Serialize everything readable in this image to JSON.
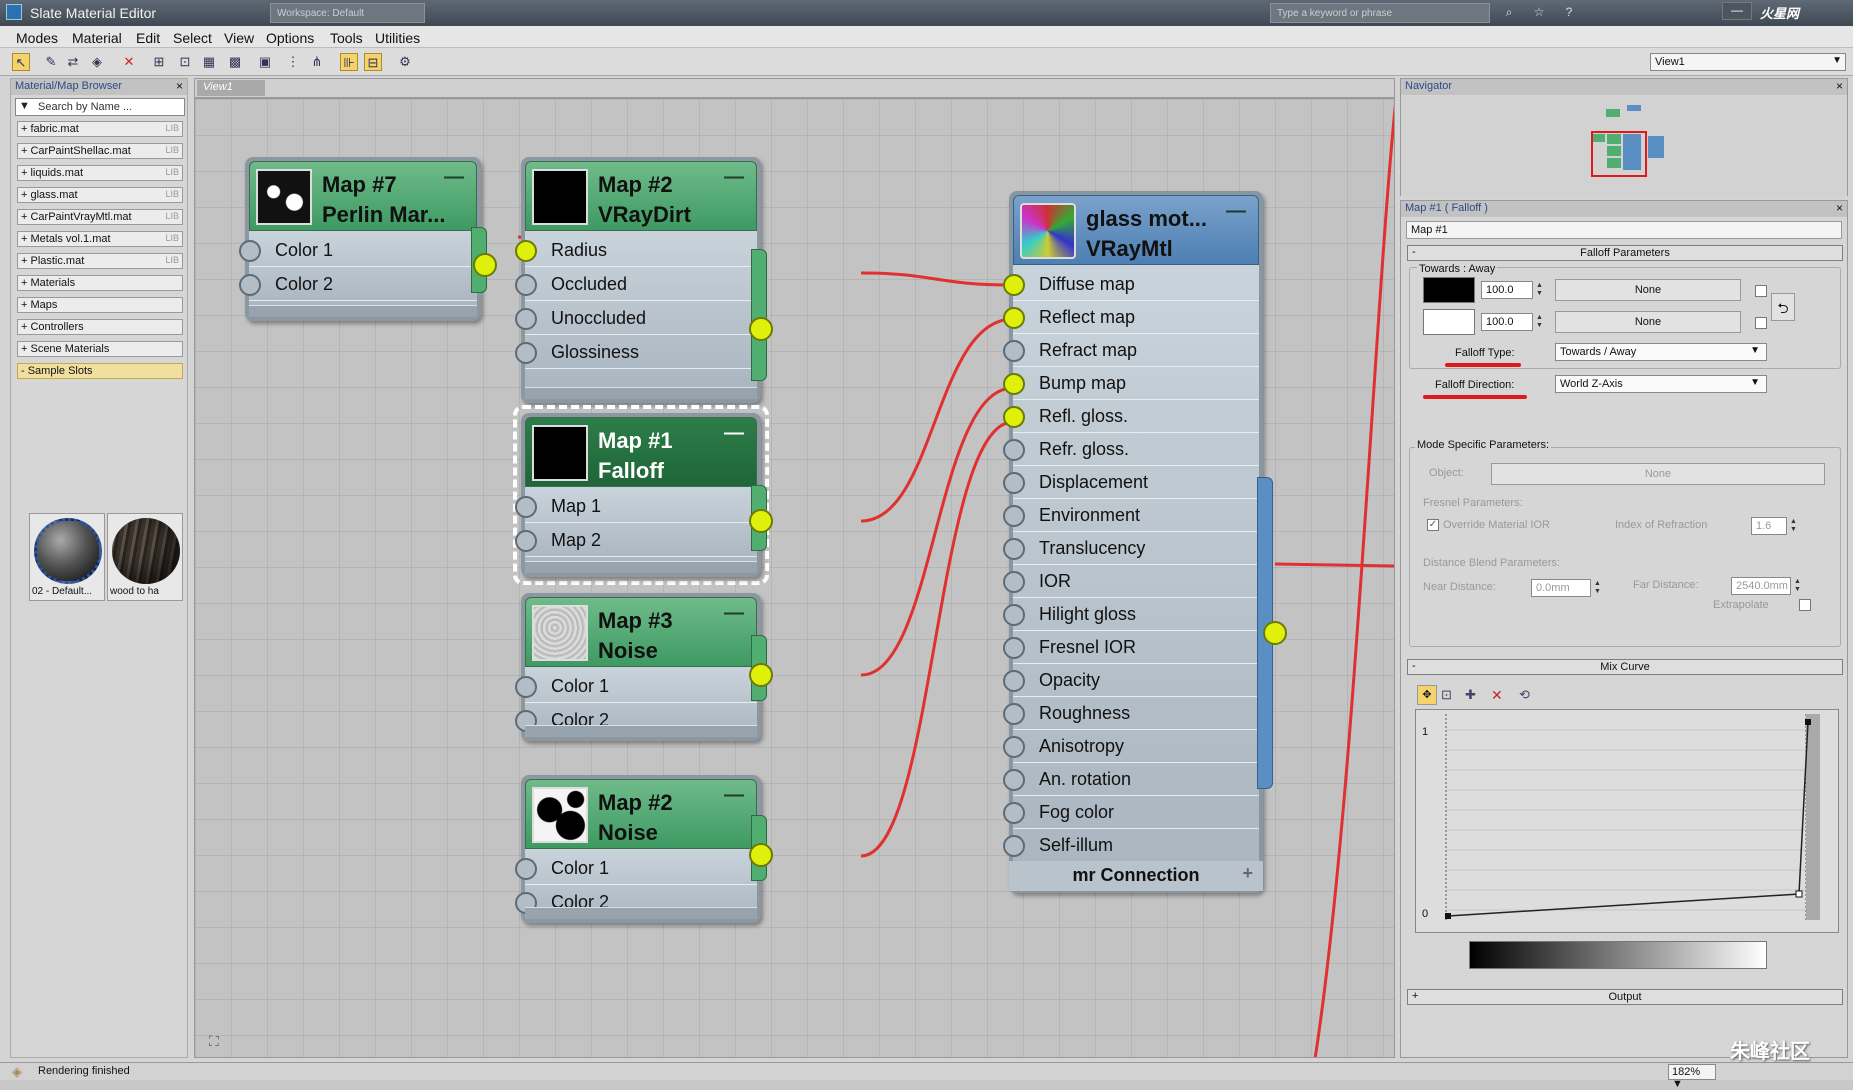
{
  "window": {
    "title": "Slate Material Editor",
    "workspace_field": "Workspace: Default",
    "search_placeholder": "Type a keyword or phrase",
    "logo": "火星网"
  },
  "menu": [
    "Modes",
    "Material",
    "Edit",
    "Select",
    "View",
    "Options",
    "Tools",
    "Utilities"
  ],
  "toolbar": {
    "view_select": "View1"
  },
  "browser": {
    "title": "Material/Map Browser",
    "search_placeholder": "Search by Name ...",
    "libraries": [
      {
        "label": "+ fabric.mat",
        "tag": "LIB"
      },
      {
        "label": "+ CarPaintShellac.mat",
        "tag": "LIB"
      },
      {
        "label": "+ liquids.mat",
        "tag": "LIB"
      },
      {
        "label": "+ glass.mat",
        "tag": "LIB"
      },
      {
        "label": "+ CarPaintVrayMtl.mat",
        "tag": "LIB"
      },
      {
        "label": "+ Metals vol.1.mat",
        "tag": "LIB"
      },
      {
        "label": "+ Plastic.mat",
        "tag": "LIB"
      },
      {
        "label": "+ Materials",
        "tag": ""
      },
      {
        "label": "+ Maps",
        "tag": ""
      },
      {
        "label": "+ Controllers",
        "tag": ""
      },
      {
        "label": "+ Scene Materials",
        "tag": ""
      },
      {
        "label": "- Sample Slots",
        "tag": ""
      }
    ],
    "slots": [
      "02 - Default...",
      "wood to ha"
    ]
  },
  "view": {
    "tab": "View1"
  },
  "nodes": {
    "map7": {
      "title": "Map #7",
      "type": "Perlin Mar...",
      "inputs": [
        "Color 1",
        "Color 2"
      ]
    },
    "map2_dirt": {
      "title": "Map #2",
      "type": "VRayDirt",
      "inputs": [
        "Radius",
        "Occluded",
        "Unoccluded",
        "Glossiness"
      ]
    },
    "map1": {
      "title": "Map #1",
      "type": "Falloff",
      "inputs": [
        "Map 1",
        "Map 2"
      ]
    },
    "map3": {
      "title": "Map #3",
      "type": "Noise",
      "inputs": [
        "Color 1",
        "Color 2"
      ]
    },
    "map2_noise": {
      "title": "Map #2",
      "type": "Noise",
      "inputs": [
        "Color 1",
        "Color 2"
      ]
    },
    "mtl": {
      "title": "glass mot...",
      "type": "VRayMtl",
      "inputs": [
        "Diffuse map",
        "Reflect map",
        "Refract map",
        "Bump map",
        "Refl. gloss.",
        "Refr. gloss.",
        "Displacement",
        "Environment",
        "Translucency",
        "IOR",
        "Hilight gloss",
        "Fresnel IOR",
        "Opacity",
        "Roughness",
        "Anisotropy",
        "An. rotation",
        "Fog color",
        "Self-illum"
      ],
      "connected": [
        0,
        1,
        3,
        4
      ],
      "mr": "mr Connection"
    }
  },
  "navigator": {
    "title": "Navigator"
  },
  "params": {
    "header": "Map #1  ( Falloff )",
    "name": "Map #1",
    "falloff_rollout": "Falloff Parameters",
    "towards_away": "Towards : Away",
    "row1_value": "100.0",
    "row2_value": "100.0",
    "none": "None",
    "falloff_type_label": "Falloff Type:",
    "falloff_type": "Towards / Away",
    "falloff_dir_label": "Falloff Direction:",
    "falloff_dir": "World Z-Axis",
    "mode_specific": "Mode Specific Parameters:",
    "object_label": "Object:",
    "fresnel_params": "Fresnel Parameters:",
    "override_ior": "Override Material IOR",
    "ior_label": "Index of Refraction",
    "ior_value": "1.6",
    "distance_blend": "Distance Blend Parameters:",
    "near_label": "Near Distance:",
    "near_value": "0.0mm",
    "far_label": "Far Distance:",
    "far_value": "2540.0mm",
    "extrapolate": "Extrapolate",
    "mix_curve": "Mix Curve",
    "curve_top": "1",
    "curve_bottom": "0",
    "output": "Output"
  },
  "status": {
    "text": "Rendering finished",
    "zoom": "182%",
    "watermark": "朱峰社区"
  },
  "colors": {
    "node_green": "#4fae70",
    "socket_on": "#dff00a",
    "wire": "#e03030",
    "mtl_blue": "#4d7fb3"
  }
}
